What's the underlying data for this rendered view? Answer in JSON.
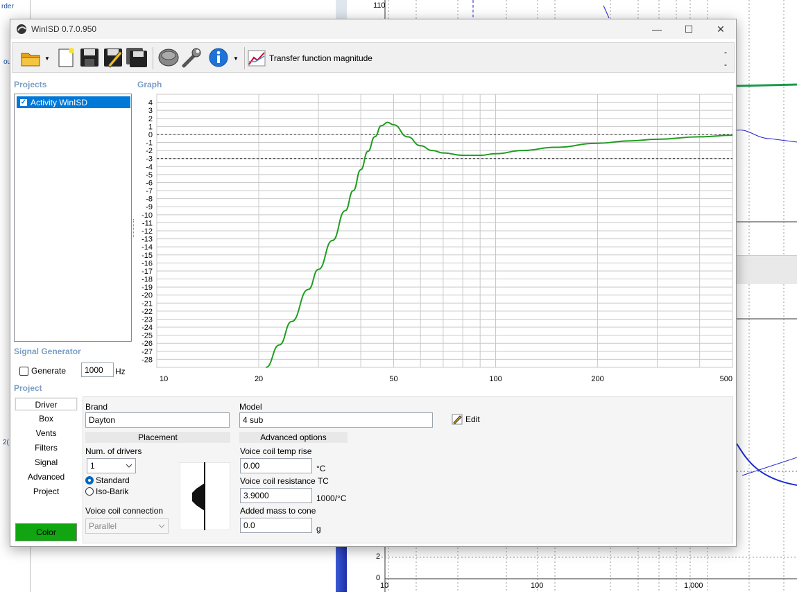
{
  "background": {
    "left_edge_texts": [
      "rder",
      "ou",
      "2("
    ],
    "top_chart_label": "110",
    "bottom_chart_y_labels": [
      "2",
      "0"
    ],
    "bottom_chart_x_labels": [
      "10",
      "100",
      "1,000"
    ]
  },
  "window": {
    "title": "WinISD 0.7.0.950",
    "icon": "app-logo-icon",
    "controls": {
      "minimize": "—",
      "maximize": "☐",
      "close": "✕"
    }
  },
  "toolbar": {
    "items": [
      "open-folder-icon",
      "new-document-icon",
      "save-icon",
      "edit-icon",
      "save-all-icon",
      "driver-icon",
      "wrench-icon",
      "info-icon"
    ],
    "graph_selector_label": "Transfer function magnitude",
    "graph_selector_icon": "graph-icon",
    "right_dashes": [
      "-",
      "-"
    ]
  },
  "projects": {
    "heading": "Projects",
    "items": [
      {
        "label": "Activity WinISD",
        "checked": true
      }
    ]
  },
  "graph": {
    "heading": "Graph"
  },
  "signal_generator": {
    "heading": "Signal Generator",
    "generate_label": "Generate",
    "frequency_value": "1000",
    "frequency_unit": "Hz"
  },
  "project": {
    "heading": "Project",
    "nav": [
      "Driver",
      "Box",
      "Vents",
      "Filters",
      "Signal",
      "Advanced",
      "Project"
    ],
    "active_nav": "Driver",
    "color_button": "Color",
    "color_value": "#12a512",
    "brand_label": "Brand",
    "brand_value": "Dayton",
    "model_label": "Model",
    "model_value": "4 sub",
    "edit_label": "Edit",
    "placement_heading": "Placement",
    "num_drivers_label": "Num. of drivers",
    "num_drivers_value": "1",
    "standard_label": "Standard",
    "isobarik_label": "Iso-Barik",
    "placement_selected": "Standard",
    "voice_coil_connection_label": "Voice coil connection",
    "voice_coil_connection_value": "Parallel",
    "advanced_heading": "Advanced options",
    "vc_temp_rise_label": "Voice coil temp rise",
    "vc_temp_rise_value": "0.00",
    "vc_temp_rise_unit": "°C",
    "vc_resistance_tc_label": "Voice coil resistance TC",
    "vc_resistance_tc_value": "3.9000",
    "vc_resistance_tc_unit": "1000/°C",
    "added_mass_label": "Added mass to cone",
    "added_mass_value": "0.0",
    "added_mass_unit": "g"
  },
  "chart_data": {
    "type": "line",
    "title": "",
    "xlabel": "",
    "ylabel": "",
    "x_scale": "log",
    "xlim": [
      10,
      500
    ],
    "ylim": [
      -29,
      5
    ],
    "x_tick_labels": [
      "10",
      "20",
      "50",
      "100",
      "200",
      "500"
    ],
    "y_tick_labels": [
      "4",
      "3",
      "2",
      "1",
      "0",
      "-1",
      "-2",
      "-3",
      "-4",
      "-5",
      "-6",
      "-7",
      "-8",
      "-9",
      "-10",
      "-11",
      "-12",
      "-13",
      "-14",
      "-15",
      "-16",
      "-17",
      "-18",
      "-19",
      "-20",
      "-21",
      "-22",
      "-23",
      "-24",
      "-25",
      "-26",
      "-27",
      "-28"
    ],
    "reference_lines_y": [
      0,
      -3
    ],
    "grid": true,
    "series": [
      {
        "color": "#1e9e1e",
        "x": [
          21,
          23,
          25,
          28,
          30,
          33,
          36,
          38,
          40,
          42,
          44,
          46,
          48,
          50,
          55,
          60,
          65,
          70,
          80,
          90,
          100,
          120,
          150,
          200,
          250,
          300,
          400,
          500
        ],
        "y": [
          -29,
          -26.2,
          -23.3,
          -19.3,
          -16.8,
          -13.2,
          -9.5,
          -7,
          -4.4,
          -2.1,
          -0.3,
          1.1,
          1.5,
          1.2,
          -0.3,
          -1.4,
          -2.0,
          -2.3,
          -2.6,
          -2.6,
          -2.4,
          -2.0,
          -1.6,
          -1.1,
          -0.8,
          -0.6,
          -0.3,
          -0.1
        ]
      }
    ]
  }
}
